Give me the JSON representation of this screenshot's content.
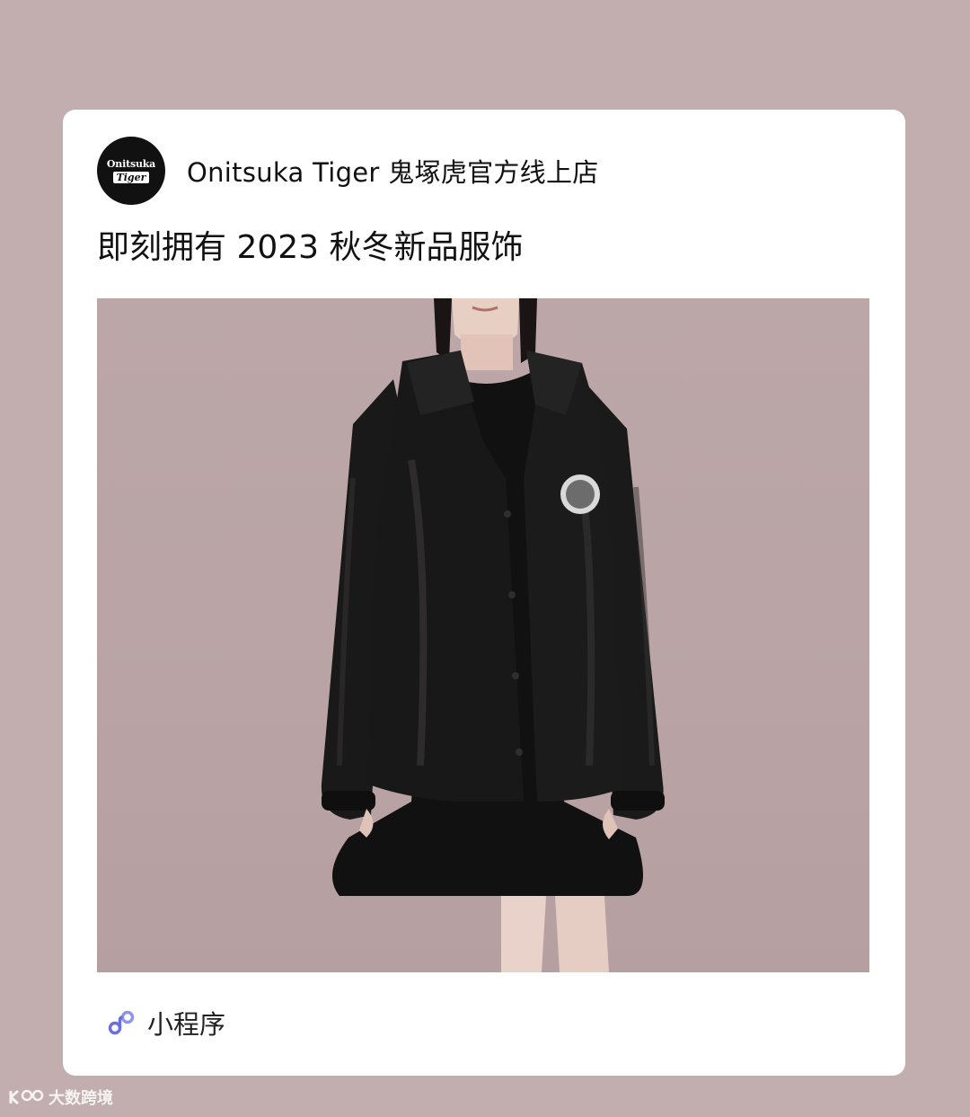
{
  "shop": {
    "avatar_line1": "Onitsuka",
    "avatar_line2": "Tiger",
    "name": "Onitsuka Tiger 鬼塚虎官方线上店"
  },
  "post": {
    "title": "即刻拥有 2023 秋冬新品服饰"
  },
  "footer": {
    "icon": "mini-program-icon",
    "label": "小程序"
  },
  "watermark": {
    "text": "大数跨境"
  },
  "colors": {
    "background": "#c2aeae",
    "card": "#ffffff",
    "mini_program_icon": "#6a6ee0"
  }
}
